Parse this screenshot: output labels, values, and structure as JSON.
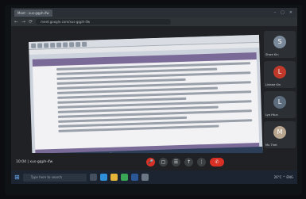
{
  "browser": {
    "tabs": [
      {
        "label": "Meet - xus-gqph-ifw",
        "active": true
      }
    ],
    "url": "meet.google.com/xus-gqph-ifw"
  },
  "presentation": {
    "toolbar_hint": "",
    "section_header": "",
    "footer_label": ""
  },
  "participants": [
    {
      "name": "Shwe Kin",
      "initial": "S",
      "color": "#7b8a9a"
    },
    {
      "name": "Lishwe Kin",
      "initial": "L",
      "color": "#c0392b"
    },
    {
      "name": "Lya Htun",
      "initial": "L",
      "color": "#5d6d7e"
    },
    {
      "name": "Mu Thet",
      "initial": "M",
      "color": "#b9a68f"
    }
  ],
  "meeting": {
    "info": "10:04 | xus-gqph-ifw"
  },
  "controls": {
    "mic": "🎤",
    "camera": "▢",
    "captions": "☰",
    "present": "↑",
    "more": "⋮",
    "end": "✆"
  },
  "taskbar": {
    "search_placeholder": "Type here to search",
    "tray_text": "26°C ^ ENG"
  },
  "colors": {
    "meet_bg": "#202124",
    "end_call": "#d93025",
    "header_purple": "#7a6a98"
  }
}
